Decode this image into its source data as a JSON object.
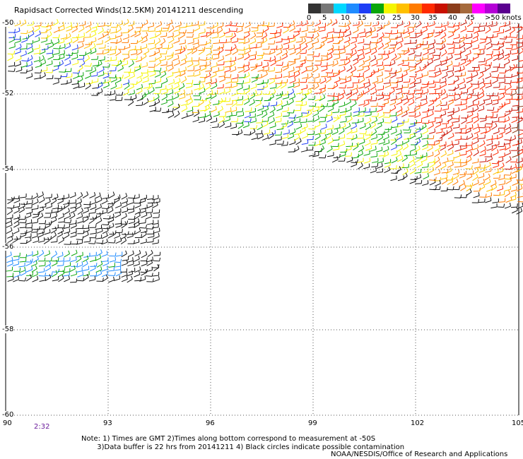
{
  "title": "Rapidsact Corrected Winds(12.5KM) 20141211 descending",
  "legend": {
    "labels": [
      "0",
      "5",
      "10",
      "15",
      "20",
      "25",
      "30",
      "35",
      "40",
      "45",
      ">50 knots"
    ],
    "colors": [
      "#333333",
      "#777777",
      "#00d8ff",
      "#1f8bff",
      "#1e3df5",
      "#0aa60a",
      "#f5f500",
      "#ffc000",
      "#ff7b00",
      "#ff2a00",
      "#c81000",
      "#8b3c1a",
      "#a56a3c",
      "#ff00ff",
      "#b400d6",
      "#5a008f"
    ]
  },
  "axes": {
    "x_ticks": [
      "90",
      "93",
      "96",
      "99",
      "102",
      "105"
    ],
    "y_ticks": [
      "-50",
      "-52",
      "-54",
      "-56",
      "-58",
      "-60"
    ]
  },
  "time_label": "2:32",
  "notes": {
    "line1": "Note: 1) Times are GMT 2)Times along bottom correspond to measurement at -50S",
    "line2": "       3)Data buffer is 22 hrs from 20141211 4) Black circles indicate possible contamination"
  },
  "credit": "NOAA/NESDIS/Office of Research and Applications"
}
